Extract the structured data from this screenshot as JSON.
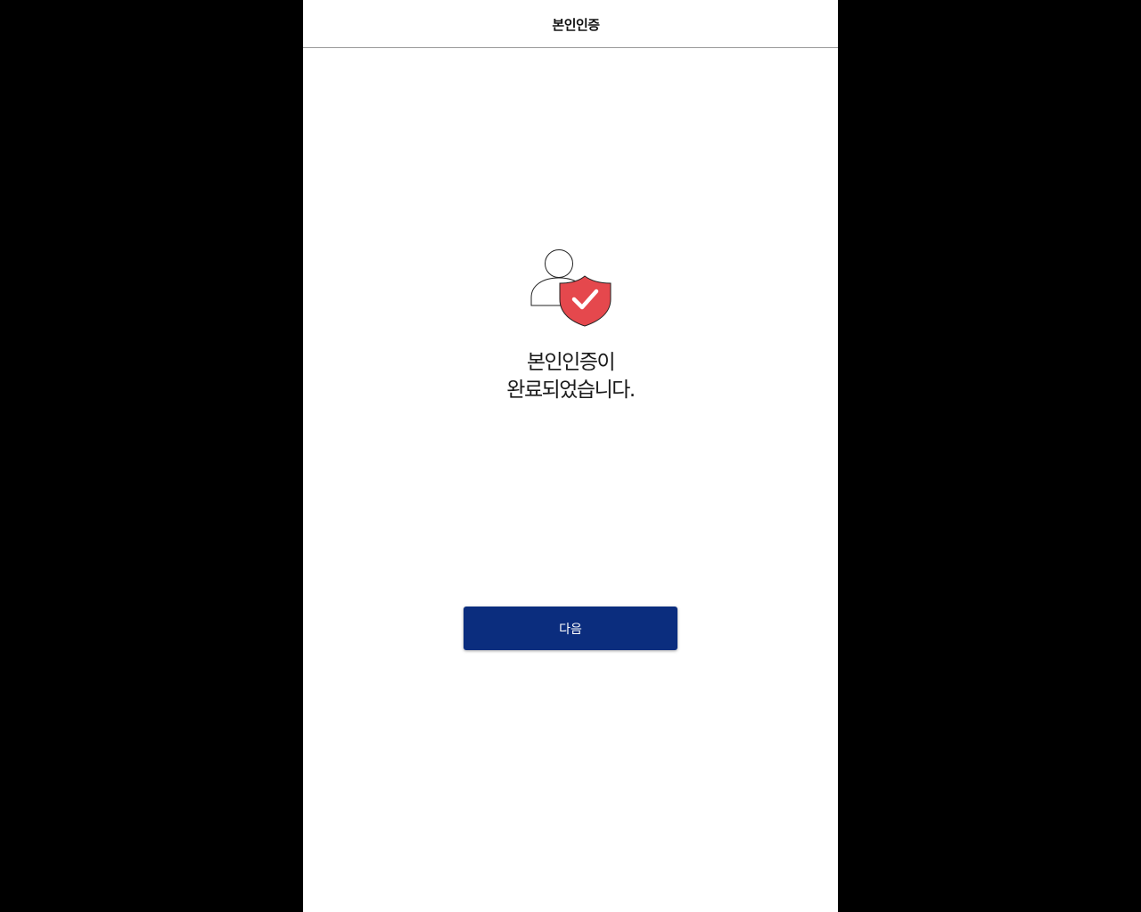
{
  "header": {
    "title": "본인인증"
  },
  "main": {
    "illustration_icon": "verified-user-shield-icon",
    "message_line1": "본인인증이",
    "message_line2": "완료되었습니다."
  },
  "actions": {
    "next_label": "다음"
  },
  "colors": {
    "button_bg": "#0b2d7e",
    "shield_red": "#e5484d",
    "frame_bg": "#000000"
  }
}
